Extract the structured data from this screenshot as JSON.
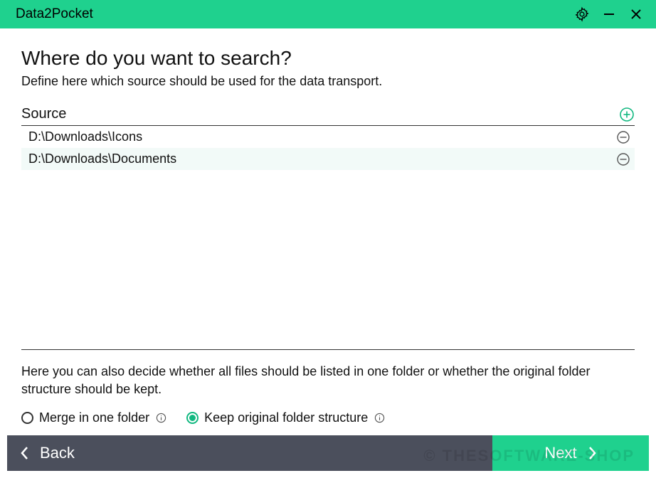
{
  "app": {
    "title": "Data2Pocket"
  },
  "colors": {
    "accent": "#1fd18e",
    "footer": "#4b4f5c"
  },
  "main": {
    "heading": "Where do you want to search?",
    "subheading": "Define here which source should be used for the data transport.",
    "source_label": "Source",
    "sources": [
      {
        "path": "D:\\Downloads\\Icons"
      },
      {
        "path": "D:\\Downloads\\Documents"
      }
    ],
    "option_text": "Here you can also decide whether all files should be listed in one folder or whether the original folder structure should be kept.",
    "options": {
      "merge": "Merge in one folder",
      "keep": "Keep original folder structure",
      "selected": "keep"
    }
  },
  "footer": {
    "back": "Back",
    "next": "Next"
  },
  "watermark": "© THESOFTWARE-SHOP"
}
